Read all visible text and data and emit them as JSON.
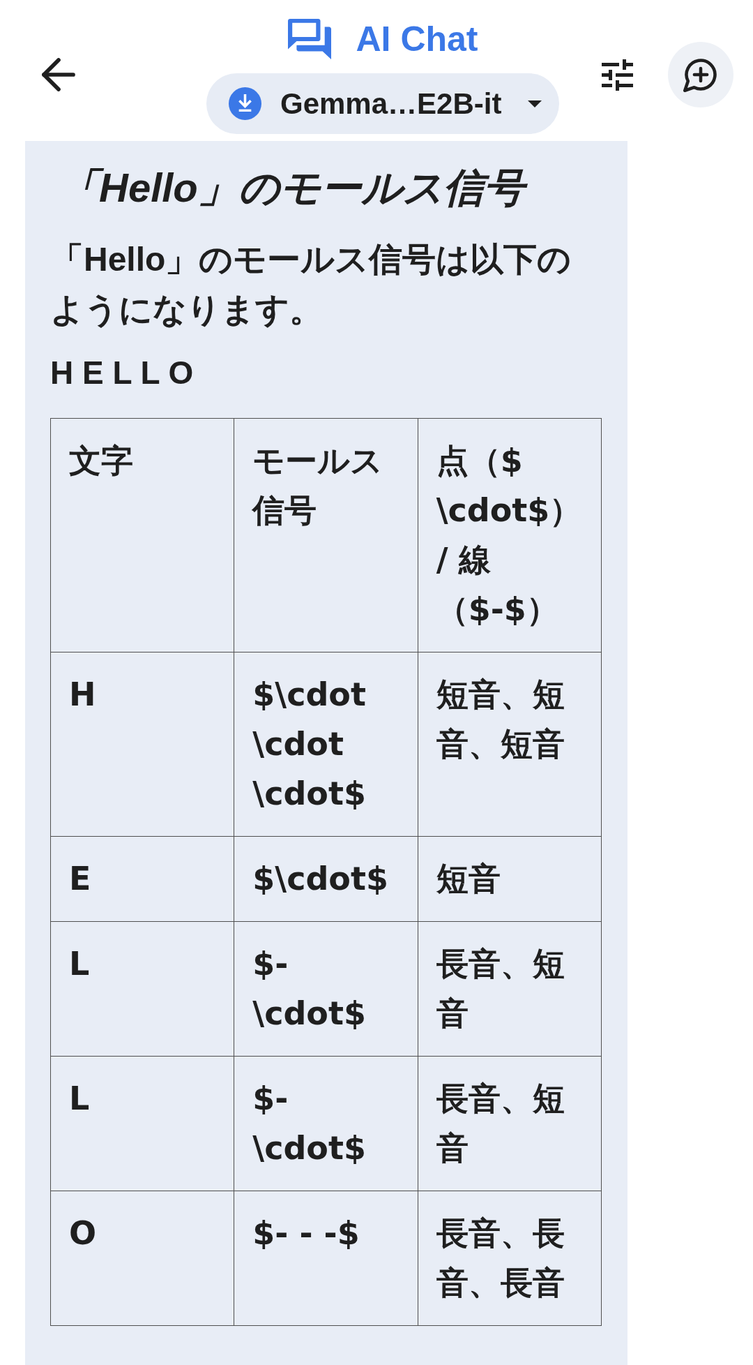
{
  "app_bar": {
    "title": "AI Chat",
    "model_selector": {
      "label": "Gemma…E2B-it"
    }
  },
  "message": {
    "heading": "「Hello」のモールス信号",
    "paragraph": "「Hello」のモールス信号は以下のようになります。",
    "letters": "H E L L O",
    "table": {
      "columns": [
        "文字",
        "モールス信号",
        "点（$ \\cdot$） / 線（$-$）"
      ],
      "rows": [
        [
          "H",
          "$\\cdot \\cdot \\cdot$",
          "短音、短音、短音"
        ],
        [
          "E",
          "$\\cdot$",
          "短音"
        ],
        [
          "L",
          "$- \\cdot$",
          "長音、短音"
        ],
        [
          "L",
          "$- \\cdot$",
          "長音、短音"
        ],
        [
          "O",
          "$- - -$",
          "長音、長音、長音"
        ]
      ]
    }
  }
}
